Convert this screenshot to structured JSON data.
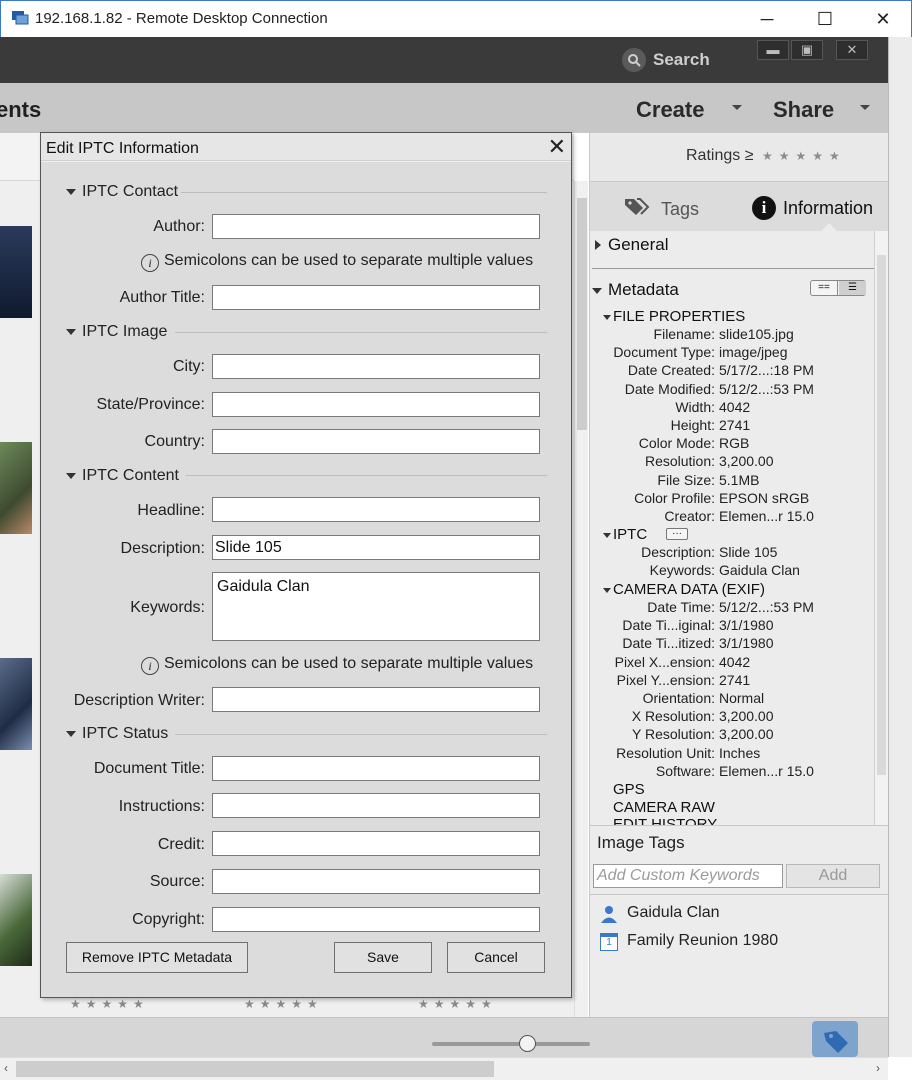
{
  "window": {
    "title": "192.168.1.82 - Remote Desktop Connection",
    "minimize": "─",
    "maximize": "☐",
    "close": "✕"
  },
  "app": {
    "search_label": "Search",
    "section_title": "ents",
    "create_label": "Create",
    "share_label": "Share",
    "window_buttons": [
      "▬",
      "▣",
      "✕"
    ]
  },
  "right_panel": {
    "ratings_label": "Ratings",
    "ratings_op": "≥",
    "ratings_stars": "★★★★★",
    "tabs": {
      "tags": "Tags",
      "information": "Information"
    },
    "general_label": "General",
    "metadata_label": "Metadata",
    "toggle": [
      "==",
      "☰"
    ],
    "file_properties_label": "FILE PROPERTIES",
    "file_properties": [
      {
        "k": "Filename:",
        "v": "slide105.jpg"
      },
      {
        "k": "Document Type:",
        "v": "image/jpeg"
      },
      {
        "k": "Date Created:",
        "v": "5/17/2...:18 PM"
      },
      {
        "k": "Date Modified:",
        "v": "5/12/2...:53 PM"
      },
      {
        "k": "Width:",
        "v": "4042"
      },
      {
        "k": "Height:",
        "v": "2741"
      },
      {
        "k": "Color Mode:",
        "v": "RGB"
      },
      {
        "k": "Resolution:",
        "v": "3,200.00"
      },
      {
        "k": "File Size:",
        "v": "5.1MB"
      },
      {
        "k": "Color Profile:",
        "v": "EPSON sRGB"
      },
      {
        "k": "Creator:",
        "v": "Elemen...r 15.0"
      }
    ],
    "iptc_label": "IPTC",
    "iptc_more": "···",
    "iptc": [
      {
        "k": "Description:",
        "v": "Slide 105"
      },
      {
        "k": "Keywords:",
        "v": "Gaidula Clan"
      }
    ],
    "camera_label": "CAMERA DATA (EXIF)",
    "camera": [
      {
        "k": "Date Time:",
        "v": "5/12/2...:53 PM"
      },
      {
        "k": "Date Ti...iginal:",
        "v": "3/1/1980"
      },
      {
        "k": "Date Ti...itized:",
        "v": "3/1/1980"
      },
      {
        "k": "Pixel X...ension:",
        "v": "4042"
      },
      {
        "k": "Pixel Y...ension:",
        "v": "2741"
      },
      {
        "k": "Orientation:",
        "v": "Normal"
      },
      {
        "k": "X Resolution:",
        "v": "3,200.00"
      },
      {
        "k": "Y Resolution:",
        "v": "3,200.00"
      },
      {
        "k": "Resolution Unit:",
        "v": "Inches"
      },
      {
        "k": "Software:",
        "v": "Elemen...r 15.0"
      }
    ],
    "gps_label": "GPS",
    "camera_raw_label": "CAMERA RAW",
    "edit_history_label": "EDIT HISTORY",
    "image_tags_label": "Image Tags",
    "keyword_placeholder": "Add Custom Keywords",
    "add_label": "Add",
    "tags": [
      "Gaidula Clan",
      "Family Reunion 1980"
    ],
    "calendar_day": "1"
  },
  "grid": {
    "stars": "★★★★★"
  },
  "dialog": {
    "title": "Edit IPTC Information",
    "close": "✕",
    "contact_group": "IPTC Contact",
    "author_label": "Author:",
    "author_value": "",
    "hint": "Semicolons can be used to separate multiple values",
    "author_title_label": "Author Title:",
    "author_title_value": "",
    "image_group": "IPTC Image",
    "city_label": "City:",
    "city_value": "",
    "state_label": "State/Province:",
    "state_value": "",
    "country_label": "Country:",
    "country_value": "",
    "content_group": "IPTC Content",
    "headline_label": "Headline:",
    "headline_value": "",
    "description_label": "Description:",
    "description_value": "Slide 105",
    "keywords_label": "Keywords:",
    "keywords_value": "Gaidula Clan",
    "desc_writer_label": "Description Writer:",
    "desc_writer_value": "",
    "status_group": "IPTC Status",
    "doc_title_label": "Document Title:",
    "doc_title_value": "",
    "instructions_label": "Instructions:",
    "instructions_value": "",
    "credit_label": "Credit:",
    "credit_value": "",
    "source_label": "Source:",
    "source_value": "",
    "copyright_label": "Copyright:",
    "copyright_value": "",
    "remove_label": "Remove IPTC Metadata",
    "save_label": "Save",
    "cancel_label": "Cancel",
    "info_glyph": "i"
  }
}
